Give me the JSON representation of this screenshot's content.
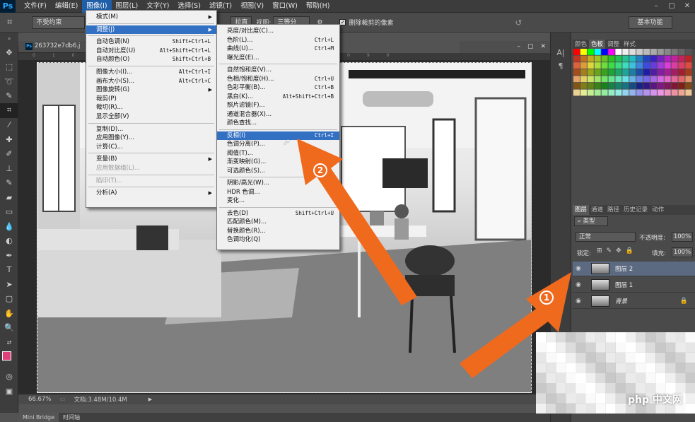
{
  "app": {
    "logo": "Ps"
  },
  "menubar": {
    "items": [
      "文件(F)",
      "编辑(E)",
      "图像(I)",
      "图层(L)",
      "文字(Y)",
      "选择(S)",
      "滤镜(T)",
      "视图(V)",
      "窗口(W)",
      "帮助(H)"
    ],
    "active_index": 2,
    "win_min": "–",
    "win_max": "▢",
    "win_close": "✕"
  },
  "options": {
    "constraint": "不受约束",
    "straighten": "拉直",
    "view_label": "视图:",
    "view_value": "三等分",
    "delete_cropped": "删除裁剪的像素",
    "workspace": "基本功能"
  },
  "document": {
    "tab_title": "263732e7db6.j",
    "zoom": "66.67%",
    "doc_info": "文档:3.48M/10.4M"
  },
  "bottom_tabs": [
    "Mini Bridge",
    "时间轴"
  ],
  "image_menu": {
    "items": [
      {
        "label": "模式(M)",
        "shortcut": "",
        "submenu": true
      },
      {
        "sep": true
      },
      {
        "label": "调整(J)",
        "shortcut": "",
        "submenu": true,
        "highlight": true
      },
      {
        "sep": true
      },
      {
        "label": "自动色调(N)",
        "shortcut": "Shift+Ctrl+L"
      },
      {
        "label": "自动对比度(U)",
        "shortcut": "Alt+Shift+Ctrl+L"
      },
      {
        "label": "自动颜色(O)",
        "shortcut": "Shift+Ctrl+B"
      },
      {
        "sep": true
      },
      {
        "label": "图像大小(I)...",
        "shortcut": "Alt+Ctrl+I"
      },
      {
        "label": "画布大小(S)...",
        "shortcut": "Alt+Ctrl+C"
      },
      {
        "label": "图像旋转(G)",
        "shortcut": "",
        "submenu": true
      },
      {
        "label": "裁剪(P)",
        "shortcut": ""
      },
      {
        "label": "裁切(R)...",
        "shortcut": ""
      },
      {
        "label": "显示全部(V)",
        "shortcut": ""
      },
      {
        "sep": true
      },
      {
        "label": "复制(D)...",
        "shortcut": ""
      },
      {
        "label": "应用图像(Y)...",
        "shortcut": ""
      },
      {
        "label": "计算(C)...",
        "shortcut": ""
      },
      {
        "sep": true
      },
      {
        "label": "变量(B)",
        "shortcut": "",
        "submenu": true
      },
      {
        "label": "应用数据组(L)...",
        "shortcut": "",
        "disabled": true
      },
      {
        "sep": true
      },
      {
        "label": "陷印(T)...",
        "shortcut": "",
        "disabled": true
      },
      {
        "sep": true
      },
      {
        "label": "分析(A)",
        "shortcut": "",
        "submenu": true
      }
    ]
  },
  "adjust_menu": {
    "items": [
      {
        "label": "亮度/对比度(C)...",
        "shortcut": ""
      },
      {
        "label": "色阶(L)...",
        "shortcut": "Ctrl+L"
      },
      {
        "label": "曲线(U)...",
        "shortcut": "Ctrl+M"
      },
      {
        "label": "曝光度(E)...",
        "shortcut": ""
      },
      {
        "sep": true
      },
      {
        "label": "自然饱和度(V)...",
        "shortcut": ""
      },
      {
        "label": "色相/饱和度(H)...",
        "shortcut": "Ctrl+U"
      },
      {
        "label": "色彩平衡(B)...",
        "shortcut": "Ctrl+B"
      },
      {
        "label": "黑白(K)...",
        "shortcut": "Alt+Shift+Ctrl+B"
      },
      {
        "label": "照片滤镜(F)...",
        "shortcut": ""
      },
      {
        "label": "通道混合器(X)...",
        "shortcut": ""
      },
      {
        "label": "颜色查找...",
        "shortcut": ""
      },
      {
        "sep": true
      },
      {
        "label": "反相(I)",
        "shortcut": "Ctrl+I",
        "highlight": true
      },
      {
        "label": "色调分离(P)...",
        "shortcut": ""
      },
      {
        "label": "阈值(T)...",
        "shortcut": ""
      },
      {
        "label": "渐变映射(G)...",
        "shortcut": ""
      },
      {
        "label": "可选颜色(S)...",
        "shortcut": ""
      },
      {
        "sep": true
      },
      {
        "label": "阴影/高光(W)...",
        "shortcut": ""
      },
      {
        "label": "HDR 色调...",
        "shortcut": ""
      },
      {
        "label": "变化...",
        "shortcut": ""
      },
      {
        "sep": true
      },
      {
        "label": "去色(D)",
        "shortcut": "Shift+Ctrl+U"
      },
      {
        "label": "匹配颜色(M)...",
        "shortcut": ""
      },
      {
        "label": "替换颜色(R)...",
        "shortcut": ""
      },
      {
        "label": "色调均化(Q)",
        "shortcut": ""
      }
    ]
  },
  "right_panel": {
    "top_tabs": [
      "颜色",
      "色板",
      "调整",
      "样式"
    ],
    "active_top_tab": 1,
    "layer_tabs": [
      "图层",
      "通道",
      "路径",
      "历史记录",
      "动作"
    ],
    "kind_filter": "类型",
    "blend_mode": "正常",
    "opacity_label": "不透明度:",
    "opacity_value": "100%",
    "lock_label": "锁定:",
    "fill_label": "填充:",
    "fill_value": "100%",
    "layers": [
      {
        "name": "图层 2",
        "selected": true
      },
      {
        "name": "图层 1",
        "selected": false
      },
      {
        "name": "背景",
        "selected": false,
        "locked": true
      }
    ]
  },
  "annotations": {
    "step1": "1",
    "step2": "2",
    "watermark": "php 中文网"
  },
  "colors": {
    "arrow": "#f06a1e",
    "menu_highlight": "#3270c4"
  }
}
